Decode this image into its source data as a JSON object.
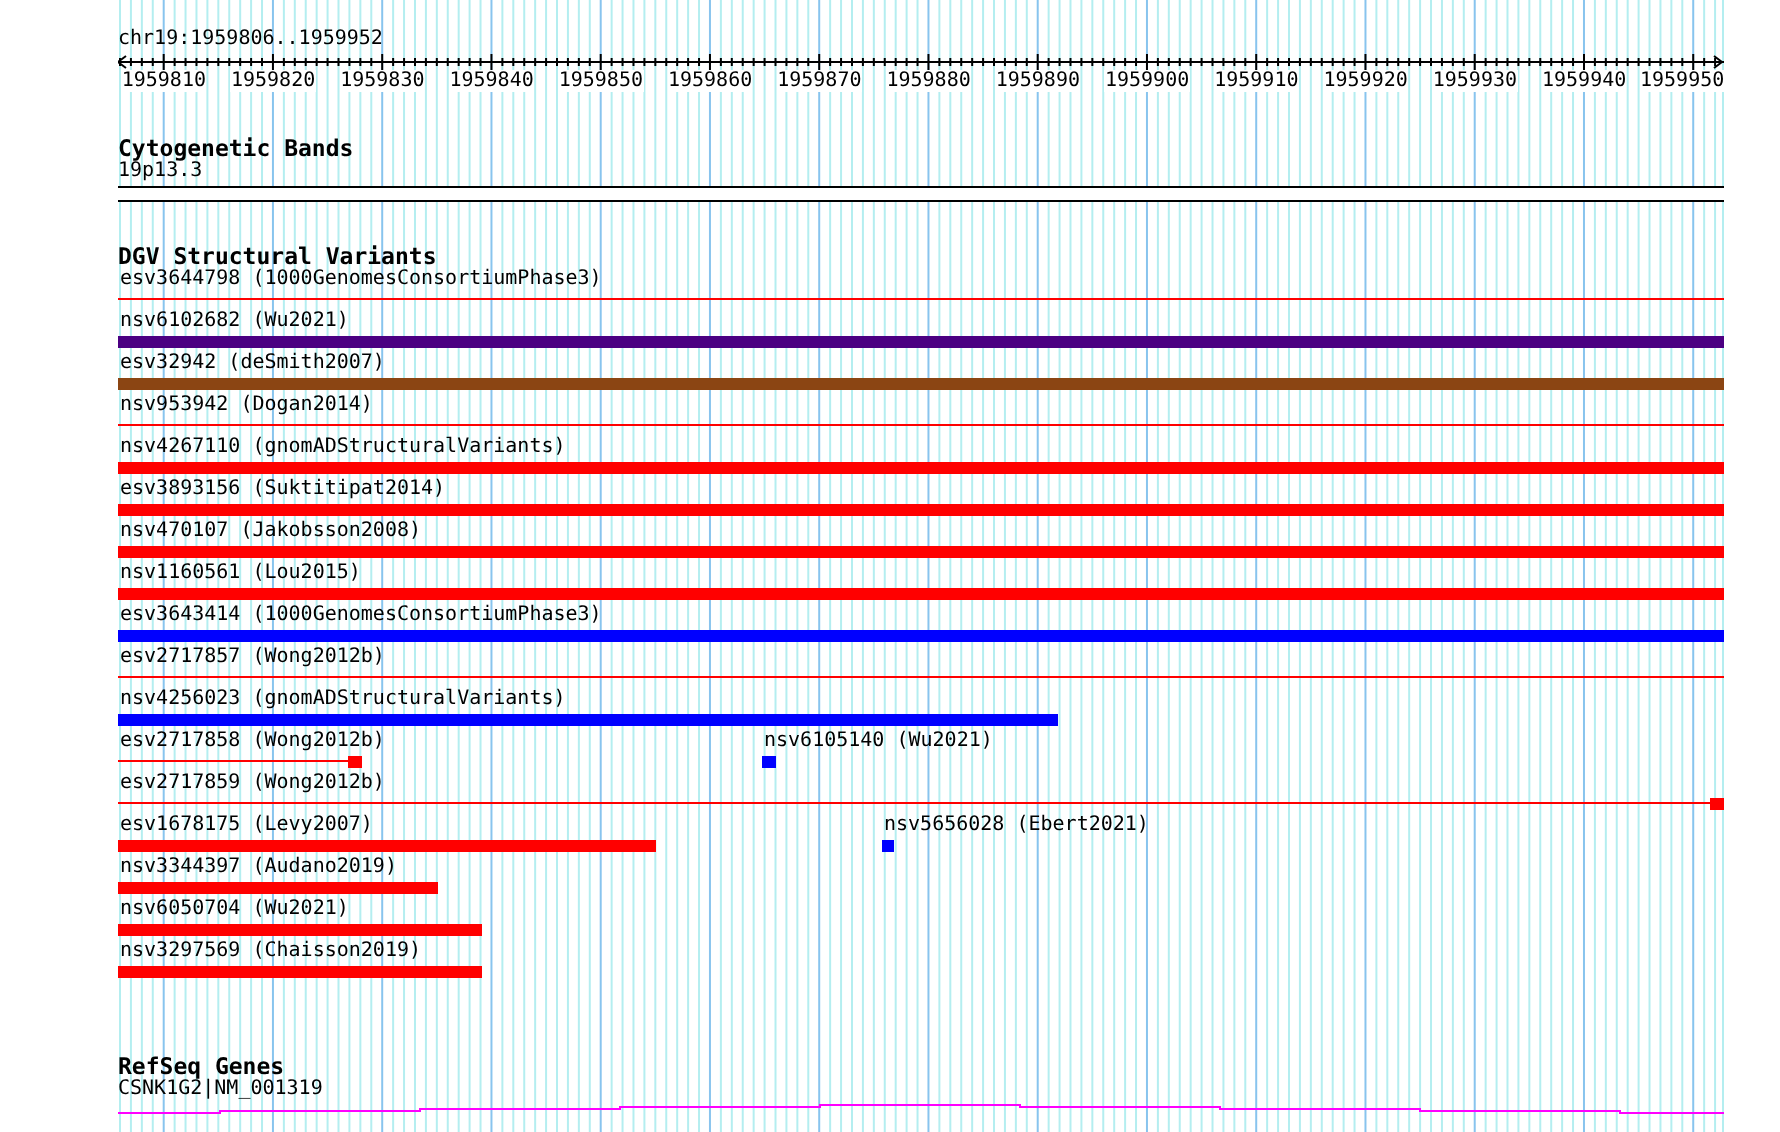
{
  "position": "chr19:1959806..1959952",
  "ruler": {
    "labels": [
      "1959810",
      "1959820",
      "1959830",
      "1959840",
      "1959850",
      "1959860",
      "1959870",
      "1959880",
      "1959890",
      "1959900",
      "1959910",
      "1959920",
      "1959930",
      "1959940",
      "1959950"
    ]
  },
  "cytogenetic_bands": {
    "title": "Cytogenetic Bands",
    "band": "19p13.3"
  },
  "dgv": {
    "title": "DGV Structural Variants",
    "rows": [
      {
        "features": [
          {
            "label": "esv3644798 (1000GenomesConsortiumPhase3)",
            "kind": "thin",
            "color": "#ff0000"
          }
        ]
      },
      {
        "features": [
          {
            "label": "nsv6102682 (Wu2021)",
            "kind": "thick",
            "color": "#4b0082"
          }
        ]
      },
      {
        "features": [
          {
            "label": "esv32942 (deSmith2007)",
            "kind": "thick",
            "color": "#8b4513"
          }
        ]
      },
      {
        "features": [
          {
            "label": "nsv953942 (Dogan2014)",
            "kind": "thin",
            "color": "#ff0000"
          }
        ]
      },
      {
        "features": [
          {
            "label": "nsv4267110 (gnomADStructuralVariants)",
            "kind": "thick",
            "color": "#ff0000"
          }
        ]
      },
      {
        "features": [
          {
            "label": "esv3893156 (Suktitipat2014)",
            "kind": "thick",
            "color": "#ff0000"
          }
        ]
      },
      {
        "features": [
          {
            "label": "nsv470107 (Jakobsson2008)",
            "kind": "thick",
            "color": "#ff0000"
          }
        ]
      },
      {
        "features": [
          {
            "label": "nsv1160561 (Lou2015)",
            "kind": "thick",
            "color": "#ff0000"
          }
        ]
      },
      {
        "features": [
          {
            "label": "esv3643414 (1000GenomesConsortiumPhase3)",
            "kind": "thick",
            "color": "#0000ff"
          }
        ]
      },
      {
        "features": [
          {
            "label": "esv2717857 (Wong2012b)",
            "kind": "thin",
            "color": "#ff0000"
          }
        ]
      },
      {
        "features": [
          {
            "label": "nsv4256023 (gnomADStructuralVariants)",
            "kind": "thick",
            "color": "#0000ff"
          }
        ]
      },
      {
        "features": [
          {
            "label": "esv2717858 (Wong2012b)",
            "kind": "thin-block",
            "color": "#ff0000"
          },
          {
            "label": "nsv6105140 (Wu2021)",
            "kind": "block",
            "color": "#0000ff"
          }
        ]
      },
      {
        "features": [
          {
            "label": "esv2717859 (Wong2012b)",
            "kind": "thin-block",
            "color": "#ff0000"
          }
        ]
      },
      {
        "features": [
          {
            "label": "esv1678175 (Levy2007)",
            "kind": "thick",
            "color": "#ff0000"
          },
          {
            "label": "nsv5656028 (Ebert2021)",
            "kind": "block",
            "color": "#0000ff"
          }
        ]
      },
      {
        "features": [
          {
            "label": "nsv3344397 (Audano2019)",
            "kind": "thick",
            "color": "#ff0000"
          }
        ]
      },
      {
        "features": [
          {
            "label": "nsv6050704 (Wu2021)",
            "kind": "thick",
            "color": "#ff0000"
          }
        ]
      },
      {
        "features": [
          {
            "label": "nsv3297569 (Chaisson2019)",
            "kind": "thick",
            "color": "#ff0000"
          }
        ]
      }
    ]
  },
  "refseq": {
    "title": "RefSeq Genes",
    "gene": "CSNK1G2|NM_001319"
  }
}
